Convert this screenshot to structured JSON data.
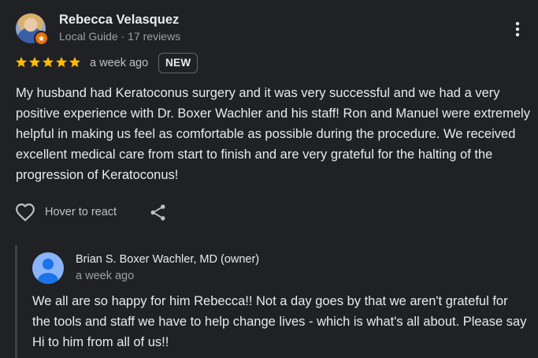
{
  "review": {
    "reviewer": {
      "name": "Rebecca Velasquez",
      "meta": "Local Guide · 17 reviews",
      "avatar_icon": "user-photo-avatar",
      "badge_icon": "local-guide-badge-icon"
    },
    "rating": 5,
    "rating_max": 5,
    "time": "a week ago",
    "badge": "NEW",
    "text": "My husband had Keratoconus surgery and it was very successful and we had a very positive experience with Dr. Boxer Wachler and his staff! Ron and Manuel were extremely helpful in making us feel as comfortable as possible during the procedure. We received excellent medical care from start to finish and are very grateful for the halting of the progression of Keratoconus!",
    "actions": {
      "react_label": "Hover to react",
      "react_icon": "heart-outline-icon",
      "share_icon": "share-icon",
      "menu_icon": "more-vertical-icon"
    }
  },
  "owner_reply": {
    "name": "Brian S. Boxer Wachler, MD (owner)",
    "time": "a week ago",
    "avatar_icon": "default-person-avatar",
    "text": "We all are so happy for him Rebecca!! Not a day goes by that we aren't grateful for the tools and staff we have to help change lives - which is what's all about. Please say Hi to him from all of us!!"
  },
  "colors": {
    "background": "#202124",
    "star": "#fbbc04",
    "text_primary": "#e8eaed",
    "text_secondary": "#9aa0a6",
    "owner_avatar": "#8ab4f8",
    "guide_badge": "#e8710a"
  }
}
